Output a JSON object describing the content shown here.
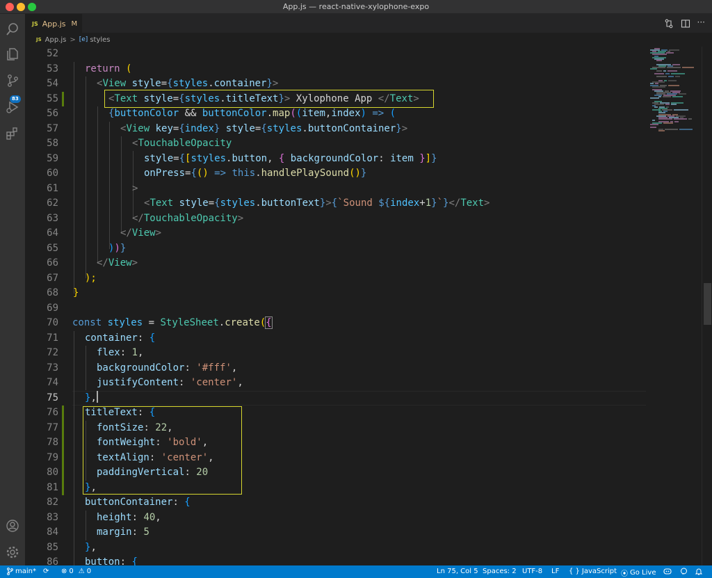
{
  "window": {
    "title": "App.js — react-native-xylophone-expo"
  },
  "activity_bar": {
    "items": [
      {
        "name": "search-icon"
      },
      {
        "name": "explorer-icon"
      },
      {
        "name": "source-control-icon",
        "badge": "83"
      },
      {
        "name": "run-debug-icon"
      },
      {
        "name": "extensions-icon"
      }
    ],
    "bottom": [
      {
        "name": "account-icon"
      },
      {
        "name": "settings-gear-icon"
      }
    ]
  },
  "tab": {
    "icon_text": "JS",
    "label": "App.js",
    "status": "M"
  },
  "breadcrumbs": {
    "icon_text": "JS",
    "file": "App.js",
    "separator": ">",
    "symbol_icon": "[e]",
    "symbol": "styles"
  },
  "editor": {
    "line_numbers": [
      "52",
      "53",
      "54",
      "55",
      "56",
      "57",
      "58",
      "59",
      "60",
      "61",
      "62",
      "63",
      "64",
      "65",
      "66",
      "67",
      "68",
      "69",
      "70",
      "71",
      "72",
      "73",
      "74",
      "75",
      "76",
      "77",
      "78",
      "79",
      "80",
      "81",
      "82",
      "83",
      "84",
      "85",
      "86"
    ],
    "active_line": "75",
    "code": {
      "l53a": "return",
      "l53b": " (",
      "l54a": "<",
      "l54b": "View",
      "l54c": " style",
      "l54d": "=",
      "l54e": "{",
      "l54f": "styles",
      "l54g": ".",
      "l54h": "container",
      "l54i": "}",
      "l54j": ">",
      "l55a": "<",
      "l55b": "Text",
      "l55c": " style",
      "l55d": "=",
      "l55e": "{",
      "l55f": "styles",
      "l55g": ".",
      "l55h": "titleText",
      "l55i": "}",
      "l55j": ">",
      "l55k": " Xylophone App ",
      "l55l": "</",
      "l55m": "Text",
      "l55n": ">",
      "l56a": "{",
      "l56b": "buttonColor",
      "l56c": " && ",
      "l56d": "buttonColor",
      "l56e": ".",
      "l56f": "map",
      "l56g": "(",
      "l56h": "(",
      "l56i": "item",
      "l56j": ",",
      "l56k": "index",
      "l56l": ")",
      "l56m": " => ",
      "l56n": "(",
      "l57a": "<",
      "l57b": "View",
      "l57c": " key",
      "l57d": "=",
      "l57e": "{",
      "l57f": "index",
      "l57g": "}",
      "l57h": " style",
      "l57i": "=",
      "l57j": "{",
      "l57k": "styles",
      "l57l": ".",
      "l57m": "buttonContainer",
      "l57n": "}",
      "l57o": ">",
      "l58a": "<",
      "l58b": "TouchableOpacity",
      "l59a": "style",
      "l59b": "=",
      "l59c": "{",
      "l59d": "[",
      "l59e": "styles",
      "l59f": ".",
      "l59g": "button",
      "l59h": ", ",
      "l59i": "{",
      "l59j": " backgroundColor",
      "l59k": ": ",
      "l59l": "item",
      "l59m": " }",
      "l59n": "]",
      "l59o": "}",
      "l60a": "onPress",
      "l60b": "=",
      "l60c": "{",
      "l60d": "()",
      "l60e": " => ",
      "l60f": "this",
      "l60g": ".",
      "l60h": "handlePlaySound",
      "l60i": "()",
      "l60j": "}",
      "l61a": ">",
      "l62a": "<",
      "l62b": "Text",
      "l62c": " style",
      "l62d": "=",
      "l62e": "{",
      "l62f": "styles",
      "l62g": ".",
      "l62h": "buttonText",
      "l62i": "}",
      "l62j": ">",
      "l62k": "{",
      "l62l": "`Sound ",
      "l62m": "${",
      "l62n": "index",
      "l62o": "+",
      "l62p": "1",
      "l62q": "}",
      "l62r": "`",
      "l62s": "}",
      "l62t": "</",
      "l62u": "Text",
      "l62v": ">",
      "l63a": "</",
      "l63b": "TouchableOpacity",
      "l63c": ">",
      "l64a": "</",
      "l64b": "View",
      "l64c": ">",
      "l65a": ")",
      "l65b": ")",
      "l65c": "}",
      "l66a": "</",
      "l66b": "View",
      "l66c": ">",
      "l67a": ");",
      "l68a": "}",
      "l70a": "const",
      "l70b": " styles",
      "l70c": " = ",
      "l70d": "StyleSheet",
      "l70e": ".",
      "l70f": "create",
      "l70g": "(",
      "l70h": "{",
      "l71a": "container",
      "l71b": ": ",
      "l71c": "{",
      "l72a": "flex",
      "l72b": ": ",
      "l72c": "1",
      "l72d": ",",
      "l73a": "backgroundColor",
      "l73b": ": ",
      "l73c": "'#fff'",
      "l73d": ",",
      "l74a": "justifyContent",
      "l74b": ": ",
      "l74c": "'center'",
      "l74d": ",",
      "l75a": "}",
      "l75b": ",",
      "l76a": "titleText",
      "l76b": ": ",
      "l76c": "{",
      "l77a": "fontSize",
      "l77b": ": ",
      "l77c": "22",
      "l77d": ",",
      "l78a": "fontWeight",
      "l78b": ": ",
      "l78c": "'bold'",
      "l78d": ",",
      "l79a": "textAlign",
      "l79b": ": ",
      "l79c": "'center'",
      "l79d": ",",
      "l80a": "paddingVertical",
      "l80b": ": ",
      "l80c": "20",
      "l81a": "}",
      "l81b": ",",
      "l82a": "buttonContainer",
      "l82b": ": ",
      "l82c": "{",
      "l83a": "height",
      "l83b": ": ",
      "l83c": "40",
      "l83d": ",",
      "l84a": "margin",
      "l84b": ": ",
      "l84c": "5",
      "l85a": "}",
      "l85b": ",",
      "l86a": "button",
      "l86b": ": ",
      "l86c": "{"
    }
  },
  "status_bar": {
    "branch": "main*",
    "sync": "⟳",
    "errors": "0",
    "warnings": "0",
    "position": "Ln 75, Col 5",
    "spaces": "Spaces: 2",
    "encoding": "UTF-8",
    "eol": "LF",
    "language_icon": "{ }",
    "language": "JavaScript",
    "golive": "Go Live"
  },
  "colors": {
    "statusbar": "#007acc",
    "highlight_box": "#d7d72f",
    "keyword": "#c586c0",
    "tag": "#4ec9b0",
    "string": "#ce9178",
    "number": "#b5cea8"
  }
}
